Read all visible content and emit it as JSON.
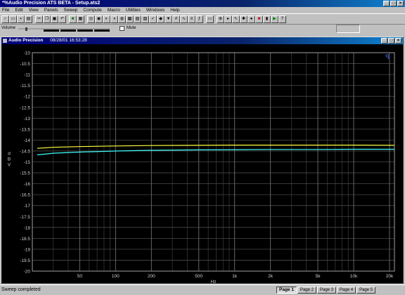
{
  "window": {
    "title": "*%Audio Precision ATS BETA - Setup.ats2"
  },
  "menu": [
    "File",
    "Edit",
    "View",
    "Panels",
    "Sweep",
    "Compute",
    "Macro",
    "Utilities",
    "Windows",
    "Help"
  ],
  "volume": {
    "label": "Volume",
    "mute_label": "Mute"
  },
  "graph_window": {
    "title": "Audio Precision",
    "datetime": "08/28/01 16:53:28"
  },
  "chart_data": {
    "type": "line",
    "xlabel": "Hz",
    "ylabel": "d B V",
    "xscale": "log",
    "xlim": [
      20,
      22000
    ],
    "ylim": [
      -20,
      -10
    ],
    "x_ticks": [
      50,
      100,
      200,
      500,
      1000,
      2000,
      5000,
      10000,
      20000
    ],
    "x_tick_labels": [
      "50",
      "100",
      "200",
      "500",
      "1k",
      "2k",
      "5k",
      "10k",
      "20k"
    ],
    "y_ticks": [
      -10,
      -10.5,
      -11,
      -11.5,
      -12,
      -12.5,
      -13,
      -13.5,
      -14,
      -14.5,
      -15,
      -15.5,
      -16,
      -16.5,
      -17,
      -17.5,
      -18,
      -18.5,
      -19,
      -19.5,
      -20
    ],
    "y_tick_labels": [
      "-10",
      "-10.5",
      "-11",
      "-11.5",
      "-12",
      "-12.5",
      "-13",
      "-13.5",
      "-14",
      "-14.5",
      "-15",
      "-15.5",
      "-16",
      "-16.5",
      "-17",
      "-17.5",
      "-18",
      "-18.5",
      "-19",
      "-19.5",
      "-20"
    ],
    "grid": true,
    "background": "#000000",
    "series": [
      {
        "color": "#ffff40",
        "x": [
          22,
          30,
          50,
          100,
          200,
          500,
          1000,
          2000,
          5000,
          10000,
          20000,
          22000
        ],
        "values": [
          -14.38,
          -14.33,
          -14.3,
          -14.27,
          -14.25,
          -14.24,
          -14.23,
          -14.23,
          -14.23,
          -14.23,
          -14.24,
          -14.24
        ]
      },
      {
        "color": "#40ffff",
        "x": [
          22,
          30,
          50,
          100,
          200,
          500,
          1000,
          2000,
          5000,
          10000,
          20000,
          22000
        ],
        "values": [
          -14.68,
          -14.6,
          -14.55,
          -14.5,
          -14.47,
          -14.45,
          -14.44,
          -14.43,
          -14.43,
          -14.42,
          -14.42,
          -14.42
        ]
      }
    ]
  },
  "status": {
    "text": "Sweep completed"
  },
  "pages": [
    "Page 1",
    "Page 2",
    "Page 3",
    "Page 4",
    "Page 5"
  ]
}
